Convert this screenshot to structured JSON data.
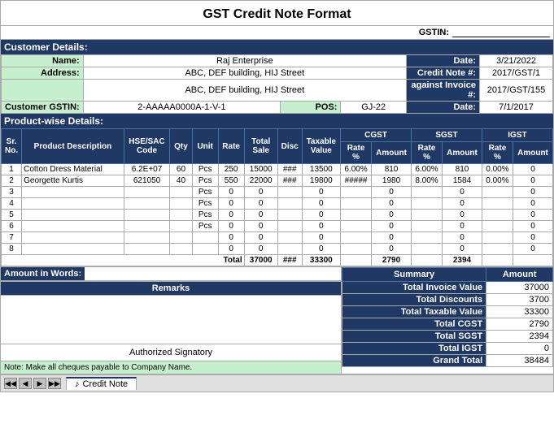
{
  "title": "GST Credit Note Format",
  "gstin_label": "GSTIN:",
  "gstin_value": "",
  "customer": {
    "section_label": "Customer Details:",
    "name_label": "Name:",
    "name_value": "Raj Enterprise",
    "address_label": "Address:",
    "address1": "ABC, DEF building, HIJ Street",
    "address2": "ABC, DEF building, HIJ Street",
    "gstin_label": "Customer GSTIN:",
    "gstin_value": "2-AAAAA0000A-1-V-1",
    "pos_label": "POS:",
    "pos_value": "GJ-22",
    "date_label": "Date:",
    "date_value": "3/21/2022",
    "credit_note_label": "Credit Note #:",
    "credit_note_value": "2017/GST/1",
    "against_invoice_label": "against Invoice #:",
    "against_invoice_value": "2017/GST/155",
    "date2_label": "Date:",
    "date2_value": "7/1/2017"
  },
  "product_section_label": "Product-wise Details:",
  "columns": {
    "sr": "Sr. No.",
    "product": "Product Description",
    "hse_sac": "HSE/SAC Code",
    "qty": "Qty",
    "unit": "Unit",
    "rate": "Rate",
    "total_sale": "Total Sale",
    "disc": "Disc",
    "taxable_value": "Taxable Value",
    "cgst": "CGST",
    "cgst_rate": "Rate %",
    "cgst_amount": "Amount",
    "sgst": "SGST",
    "sgst_rate": "Rate %",
    "sgst_amount": "Amount",
    "igst": "IGST",
    "igst_rate": "Rate %",
    "igst_amount": "Amount"
  },
  "rows": [
    {
      "sr": "1",
      "product": "Cotton Dress Material",
      "hse": "6.2E+07",
      "qty": "60",
      "unit": "Pcs",
      "rate": "250",
      "total_sale": "15000",
      "disc": "###",
      "taxable": "13500",
      "cgst_rate": "6.00%",
      "cgst_amt": "810",
      "sgst_rate": "6.00%",
      "sgst_amt": "810",
      "igst_rate": "0.00%",
      "igst_amt": "0"
    },
    {
      "sr": "2",
      "product": "Georgette Kurtis",
      "hse": "621050",
      "qty": "40",
      "unit": "Pcs",
      "rate": "550",
      "total_sale": "22000",
      "disc": "###",
      "taxable": "19800",
      "cgst_rate": "#####",
      "cgst_amt": "1980",
      "sgst_rate": "8.00%",
      "sgst_amt": "1584",
      "igst_rate": "0.00%",
      "igst_amt": "0"
    },
    {
      "sr": "3",
      "product": "",
      "hse": "",
      "qty": "",
      "unit": "Pcs",
      "rate": "0",
      "total_sale": "0",
      "disc": "",
      "taxable": "0",
      "cgst_rate": "",
      "cgst_amt": "0",
      "sgst_rate": "",
      "sgst_amt": "0",
      "igst_rate": "",
      "igst_amt": "0"
    },
    {
      "sr": "4",
      "product": "",
      "hse": "",
      "qty": "",
      "unit": "Pcs",
      "rate": "0",
      "total_sale": "0",
      "disc": "",
      "taxable": "0",
      "cgst_rate": "",
      "cgst_amt": "0",
      "sgst_rate": "",
      "sgst_amt": "0",
      "igst_rate": "",
      "igst_amt": "0"
    },
    {
      "sr": "5",
      "product": "",
      "hse": "",
      "qty": "",
      "unit": "Pcs",
      "rate": "0",
      "total_sale": "0",
      "disc": "",
      "taxable": "0",
      "cgst_rate": "",
      "cgst_amt": "0",
      "sgst_rate": "",
      "sgst_amt": "0",
      "igst_rate": "",
      "igst_amt": "0"
    },
    {
      "sr": "6",
      "product": "",
      "hse": "",
      "qty": "",
      "unit": "Pcs",
      "rate": "0",
      "total_sale": "0",
      "disc": "",
      "taxable": "0",
      "cgst_rate": "",
      "cgst_amt": "0",
      "sgst_rate": "",
      "sgst_amt": "0",
      "igst_rate": "",
      "igst_amt": "0"
    },
    {
      "sr": "7",
      "product": "",
      "hse": "",
      "qty": "",
      "unit": "",
      "rate": "0",
      "total_sale": "0",
      "disc": "",
      "taxable": "0",
      "cgst_rate": "",
      "cgst_amt": "0",
      "sgst_rate": "",
      "sgst_amt": "0",
      "igst_rate": "",
      "igst_amt": "0"
    },
    {
      "sr": "8",
      "product": "",
      "hse": "",
      "qty": "",
      "unit": "",
      "rate": "0",
      "total_sale": "0",
      "disc": "",
      "taxable": "0",
      "cgst_rate": "",
      "cgst_amt": "0",
      "sgst_rate": "",
      "sgst_amt": "0",
      "igst_rate": "",
      "igst_amt": "0"
    }
  ],
  "totals": {
    "label": "Total",
    "total_sale": "37000",
    "disc": "###",
    "taxable": "33300",
    "cgst_amt": "2790",
    "sgst_amt": "2394",
    "igst_amt": ""
  },
  "amount_in_words_label": "Amount in Words:",
  "amount_in_words_value": "",
  "remarks_label": "Remarks",
  "signatory_label": "Authorized Signatory",
  "note_text": "Note: Make all cheques payable to Company Name.",
  "summary": {
    "header": "Summary",
    "amount_header": "Amount",
    "rows": [
      {
        "label": "Total Invoice Value",
        "value": "37000"
      },
      {
        "label": "Total Discounts",
        "value": "3700"
      },
      {
        "label": "Total Taxable Value",
        "value": "33300"
      },
      {
        "label": "Total CGST",
        "value": "2790"
      },
      {
        "label": "Total SGST",
        "value": "2394"
      },
      {
        "label": "Total IGST",
        "value": "0"
      },
      {
        "label": "Grand Total",
        "value": "38484"
      }
    ]
  },
  "tab": {
    "name": "Credit Note",
    "icon": "♪"
  }
}
